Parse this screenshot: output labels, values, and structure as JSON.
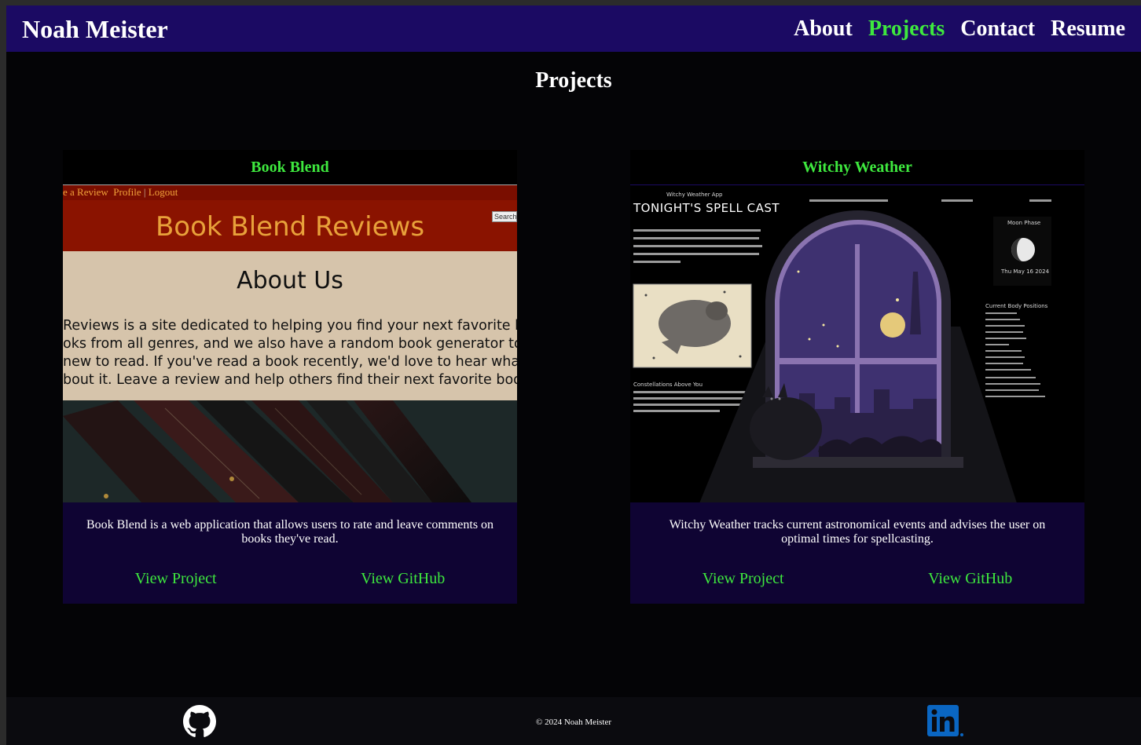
{
  "header": {
    "brand": "Noah Meister",
    "nav": [
      "About",
      "Projects",
      "Contact",
      "Resume"
    ],
    "active": "Projects"
  },
  "page": {
    "title": "Projects"
  },
  "projects": [
    {
      "title": "Book Blend",
      "description": "Book Blend is a web application that allows users to rate and leave comments on books they've read.",
      "view_project": "View Project",
      "view_github": "View GitHub",
      "preview": {
        "nav_text": "e a Review",
        "nav_profile": "Profile",
        "nav_logout": "Logout",
        "search": "Search",
        "site_title": "Book Blend Reviews",
        "about_heading": "About Us",
        "about_lines": [
          "Reviews is a site dedicated to helping you find your next favorite bo",
          "oks from all genres, and we also have a random book generator to",
          "new to read. If you've read a book recently, we'd love to hear what y",
          "bout it. Leave a review and help others find their next favorite book"
        ]
      }
    },
    {
      "title": "Witchy Weather",
      "description": "Witchy Weather tracks current astronomical events and advises the user on optimal times for spellcasting.",
      "view_project": "View Project",
      "view_github": "View GitHub",
      "preview": {
        "app_label": "Witchy Weather App",
        "big_title": "TONIGHT'S SPELL CAST",
        "moon_label": "Moon Phase",
        "moon_date": "Thu May 16 2024",
        "constellations_label": "Constellations Above You",
        "body_positions_label": "Current Body Positions"
      }
    }
  ],
  "footer": {
    "copyright": "© 2024 Noah Meister"
  },
  "colors": {
    "nav_bg": "#1b0a63",
    "accent_green": "#3ee83e",
    "card_bg": "#0f0433",
    "page_bg": "#040406"
  }
}
